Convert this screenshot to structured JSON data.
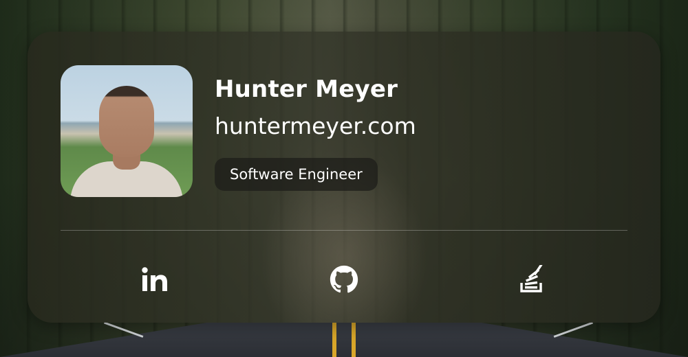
{
  "profile": {
    "name": "Hunter Meyer",
    "website": "huntermeyer.com",
    "role": "Software Engineer"
  },
  "social": [
    {
      "icon": "linkedin-icon",
      "label": "LinkedIn"
    },
    {
      "icon": "github-icon",
      "label": "GitHub"
    },
    {
      "icon": "stackoverflow-icon",
      "label": "Stack Overflow"
    }
  ],
  "colors": {
    "text": "#ffffff",
    "badge_bg": "#1e1e1a",
    "road_line": "#d9a72a"
  }
}
